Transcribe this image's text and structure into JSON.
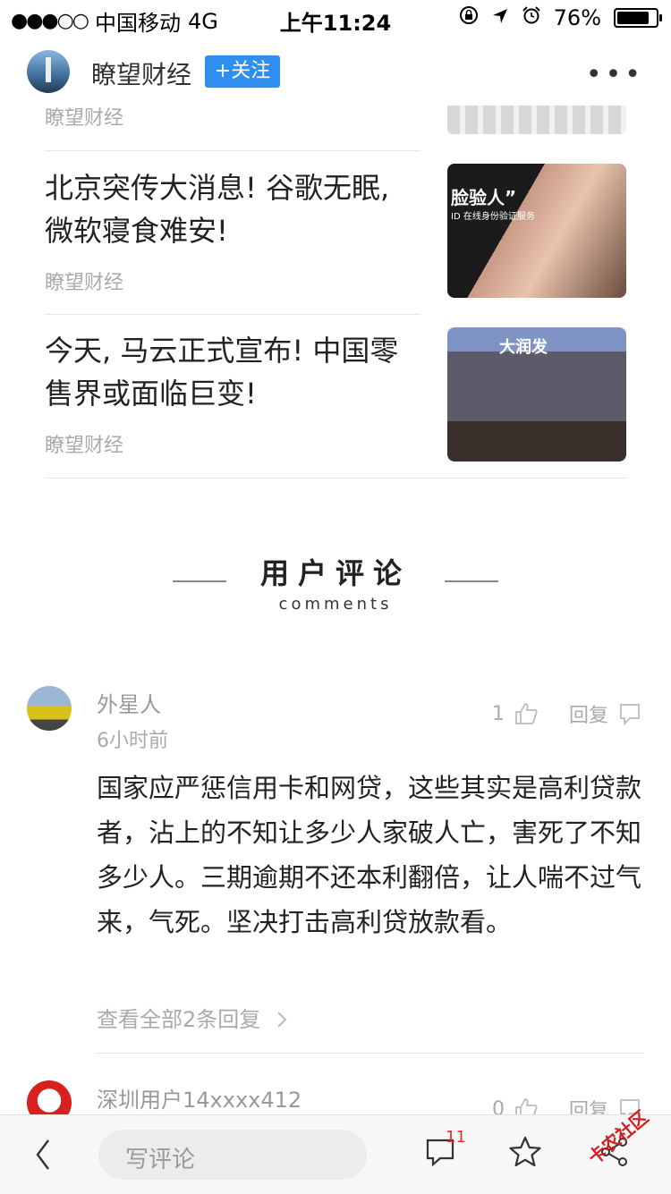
{
  "status_bar": {
    "signal": "●●●○○",
    "carrier": "中国移动",
    "network": "4G",
    "time": "上午11:24",
    "battery": "76%",
    "battery_level": 0.76
  },
  "publisher": {
    "name": "瞭望财经",
    "follow_label": "+关注"
  },
  "articles": [
    {
      "source": "瞭望财经"
    },
    {
      "title": "北京突传大消息! 谷歌无眠, 微软寝食难安!",
      "source": "瞭望财经",
      "thumb_caption": "脸验人”",
      "thumb_sub": "ID 在线身份验证服务"
    },
    {
      "title": "今天, 马云正式宣布! 中国零售界或面临巨变!",
      "source": "瞭望财经",
      "thumb_caption": "大润发"
    }
  ],
  "comments_section": {
    "title": "用户评论",
    "subtitle": "comments"
  },
  "comments": [
    {
      "user": "外星人",
      "time": "6小时前",
      "likes": "1",
      "reply_label": "回复",
      "body": "国家应严惩信用卡和网贷，这些其实是高利贷款者，沾上的不知让多少人家破人亡，害死了不知多少人。三期逾期不还本利翻倍，让人喘不过气来，气死。坚决打击高利贷放款看。",
      "view_replies": "查看全部2条回复"
    },
    {
      "user": "深圳用户14xxxx412",
      "likes": "0",
      "reply_label": "回复"
    }
  ],
  "bottom_bar": {
    "input_placeholder": "写评论",
    "comment_count": "11"
  },
  "watermark": "卡农社区",
  "colors": {
    "accent_blue": "#2f8ff0",
    "badge_red": "#e03030"
  }
}
